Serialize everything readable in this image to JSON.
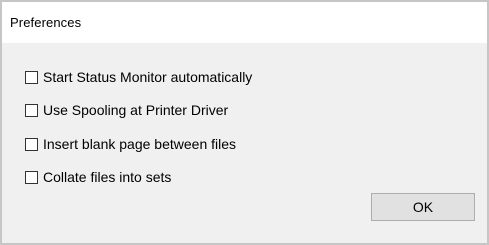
{
  "window": {
    "title": "Preferences"
  },
  "options": [
    {
      "label": "Start Status Monitor automatically",
      "checked": false
    },
    {
      "label": "Use Spooling at Printer Driver",
      "checked": false
    },
    {
      "label": "Insert blank page between files",
      "checked": false
    },
    {
      "label": "Collate files into sets",
      "checked": false
    }
  ],
  "buttons": {
    "ok_label": "OK"
  }
}
